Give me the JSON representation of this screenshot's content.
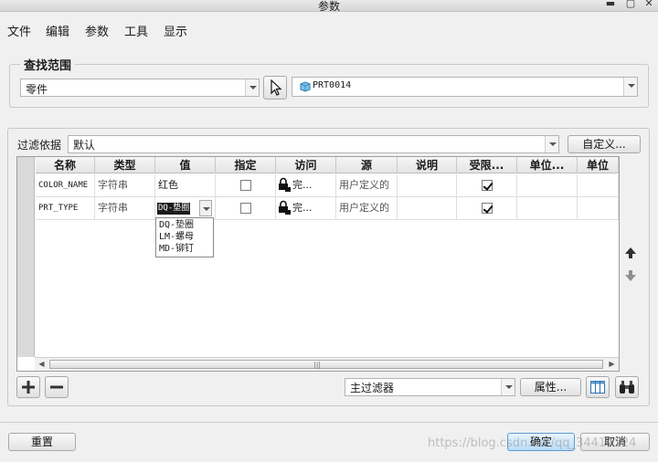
{
  "window": {
    "title": "参数",
    "min_glyph": "▬",
    "max_glyph": "▢",
    "close_glyph": "✕"
  },
  "menu": [
    "文件",
    "编辑",
    "参数",
    "工具",
    "显示"
  ],
  "scope": {
    "legend": "查找范围",
    "type_value": "零件",
    "object_value": "PRT0014"
  },
  "filter": {
    "label": "过滤依据",
    "value": "默认",
    "customize_label": "自定义..."
  },
  "table": {
    "columns": [
      "名称",
      "类型",
      "值",
      "指定",
      "访问",
      "源",
      "说明",
      "受限...",
      "单位...",
      "单位"
    ],
    "rows": [
      {
        "name": "COLOR_NAME",
        "type": "字符串",
        "value": "红色",
        "designate": false,
        "access": "完...",
        "source": "用户定义的",
        "description": "",
        "restricted": true
      },
      {
        "name": "PRT_TYPE",
        "type": "字符串",
        "value": "DQ-垫圈",
        "designate": false,
        "access": "完...",
        "source": "用户定义的",
        "description": "",
        "restricted": true
      }
    ],
    "value_options": [
      "DQ-垫圈",
      "LM-螺母",
      "MD-铆钉"
    ]
  },
  "bottom": {
    "filter_value": "主过滤器",
    "properties_label": "属性..."
  },
  "footer": {
    "reset_label": "重置",
    "ok_label": "确定",
    "cancel_label": "取消"
  },
  "watermark": "https://blog.csdn.net/qq_34414124",
  "colors": {
    "window_bg": "#f0f0f0",
    "accent": "#5c9bd0",
    "selected_text_bg": "#1a1a1a"
  }
}
